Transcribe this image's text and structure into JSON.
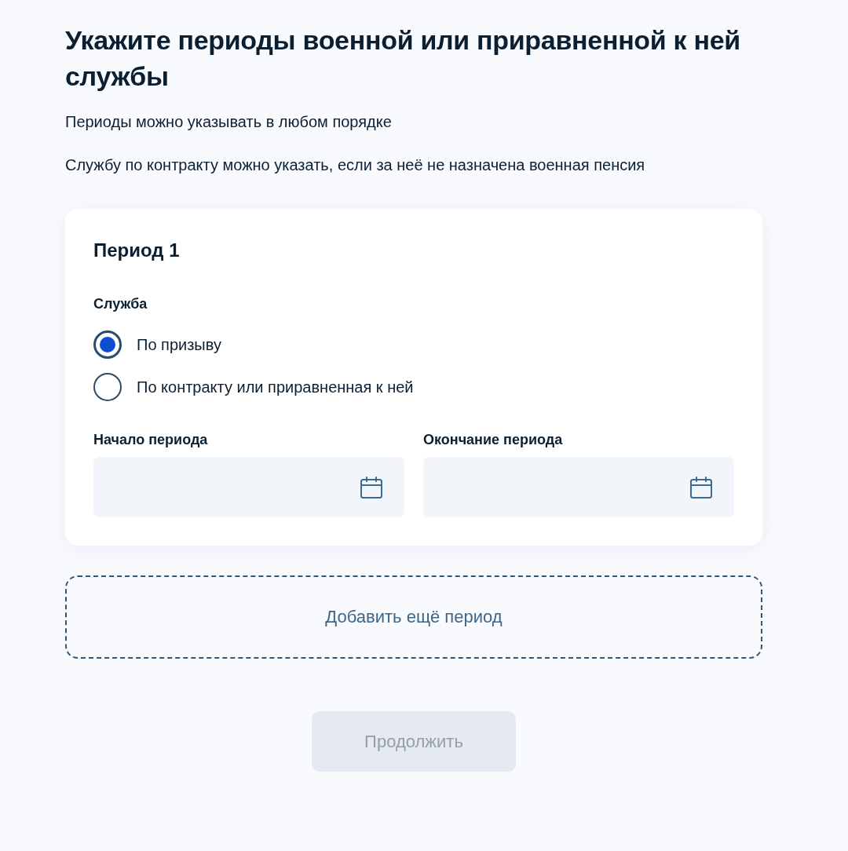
{
  "heading": "Укажите периоды военной или приравненной к ней службы",
  "notes": [
    "Периоды можно указывать в любом порядке",
    "Службу по контракту можно указать, если за неё не назначена военная пенсия"
  ],
  "periods": [
    {
      "title": "Период 1",
      "service_label": "Служба",
      "service_options": [
        {
          "label": "По призыву",
          "selected": true
        },
        {
          "label": "По контракту или приравненная к ней",
          "selected": false
        }
      ],
      "date_fields": [
        {
          "label": "Начало периода"
        },
        {
          "label": "Окончание периода"
        }
      ]
    }
  ],
  "add_button": {
    "label": "Добавить ещё период"
  },
  "continue_button": {
    "label": "Продолжить",
    "disabled": true
  }
}
